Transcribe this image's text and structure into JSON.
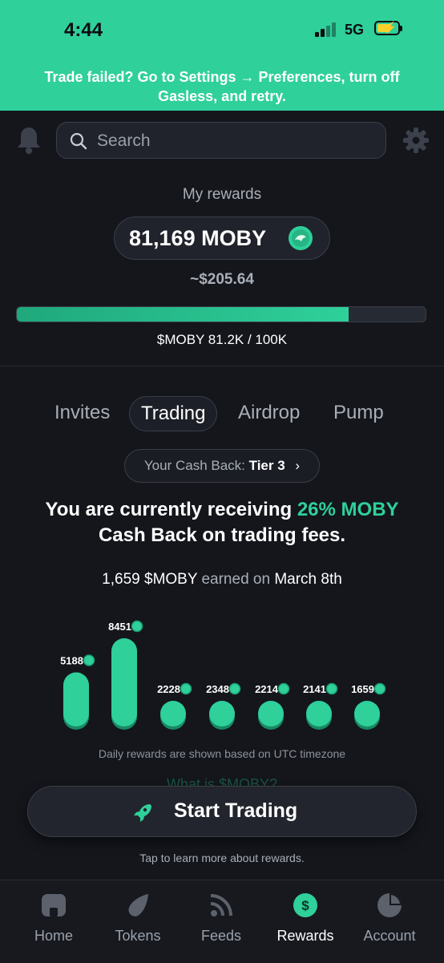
{
  "status_bar": {
    "time": "4:44",
    "network": "5G"
  },
  "banner": {
    "text": "Trade failed? Go to Settings → Preferences, turn off Gasless, and retry."
  },
  "search": {
    "placeholder": "Search"
  },
  "rewards": {
    "title": "My rewards",
    "balance": "81,169 MOBY",
    "usd_value": "~$205.64",
    "progress_fraction": 0.812,
    "progress_label": "$MOBY 81.2K / 100K"
  },
  "tabs": [
    {
      "label": "Invites"
    },
    {
      "label": "Trading"
    },
    {
      "label": "Airdrop"
    },
    {
      "label": "Pump"
    }
  ],
  "active_tab": "Trading",
  "cashback": {
    "label": "Your Cash Back:",
    "tier": "Tier 3",
    "chevron": "›"
  },
  "headline": {
    "prefix": "You are currently receiving",
    "highlight": "26% MOBY",
    "suffix": "Cash Back on trading fees."
  },
  "earned": {
    "amount": "1,659 $MOBY",
    "middle": "earned on",
    "date": "March 8th"
  },
  "chart_data": {
    "type": "bar",
    "values": [
      5188,
      8451,
      2228,
      2348,
      2214,
      2141,
      1659
    ],
    "labels": [
      "5188",
      "8451",
      "2228",
      "2348",
      "2214",
      "2141",
      "1659"
    ]
  },
  "utc_note": "Daily rewards are shown based on UTC timezone",
  "faq_link": "What is $MOBY?",
  "start_button": {
    "label": "Start Trading"
  },
  "tap_note": "Tap to learn more about rewards.",
  "nav": [
    {
      "label": "Home",
      "icon": "home-icon"
    },
    {
      "label": "Tokens",
      "icon": "comet-icon"
    },
    {
      "label": "Feeds",
      "icon": "rss-icon"
    },
    {
      "label": "Rewards",
      "icon": "dollar-icon"
    },
    {
      "label": "Account",
      "icon": "pie-icon"
    }
  ],
  "colors": {
    "accent": "#2fd09a",
    "background": "#14161c"
  }
}
